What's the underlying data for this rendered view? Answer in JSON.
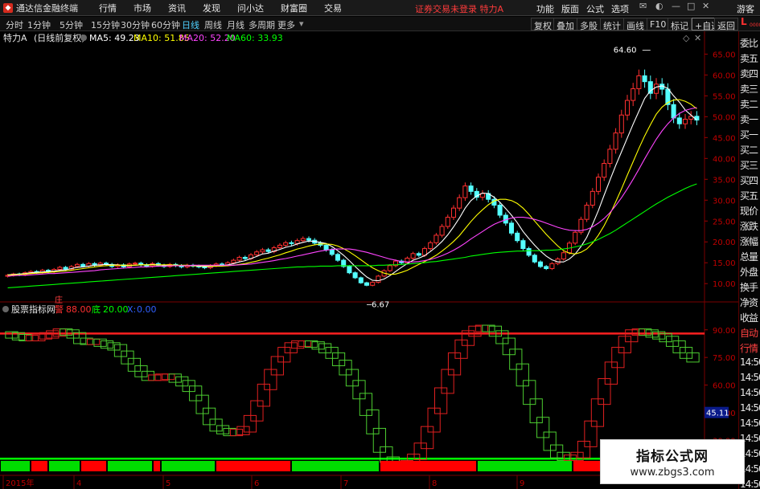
{
  "app": {
    "title": "通达信金融终端",
    "menu": [
      "行情",
      "市场",
      "资讯",
      "发现",
      "问小达",
      "财富圈",
      "交易"
    ],
    "login_status": "证券交易未登录 特力A",
    "right_menu": [
      "功能",
      "版面",
      "公式",
      "选项"
    ],
    "guest": "游客"
  },
  "periods": [
    "分时",
    "1分钟",
    "5分钟",
    "15分钟",
    "30分钟",
    "60分钟",
    "日线",
    "周线",
    "月线",
    "多周期",
    "更多"
  ],
  "active_period": "日线",
  "toolbar_buttons": [
    "复权",
    "叠加",
    "多股",
    "统计",
    "画线",
    "F10",
    "标记",
    "+自选",
    "返回"
  ],
  "main_chart_header": {
    "name": "特力A",
    "mode": "(日线前复权)",
    "ma": [
      {
        "label": "MA5: 49.23",
        "color": "#ffffff"
      },
      {
        "label": "MA10: 51.85",
        "color": "#ffff00"
      },
      {
        "label": "MA20: 52.20",
        "color": "#ff44ff"
      },
      {
        "label": "MA60: 33.93",
        "color": "#00ff00"
      }
    ]
  },
  "indicator_header": {
    "name": "股票指标网",
    "tag": "庄",
    "items": [
      {
        "label": "88.00",
        "prefix": "警",
        "color": "#ff3030"
      },
      {
        "label": "20.00",
        "prefix": "底",
        "color": "#00ff00"
      },
      {
        "label": "0.00",
        "prefix": "X:",
        "color": "#3060ff"
      }
    ]
  },
  "side_panel": [
    "委比",
    "卖五",
    "卖四",
    "卖三",
    "卖二",
    "卖一",
    "买一",
    "买二",
    "买三",
    "买四",
    "买五",
    "现价",
    "涨跌",
    "涨幅",
    "总量",
    "外盘",
    "换手",
    "净资",
    "收益",
    "自动",
    "行情",
    "14:50",
    "14:50",
    "14:50",
    "14:50",
    "14:50",
    "14:50",
    "14:50",
    "14:50",
    "14:50"
  ],
  "corner_marker": {
    "letter": "L",
    "sub": "0000"
  },
  "watermark": {
    "title": "指标公式网",
    "url": "www.zbgs3.com"
  },
  "chart_data": [
    {
      "type": "candlestick",
      "title": "特力A (日线前复权)",
      "y_ticks": [
        10.0,
        15.0,
        20.0,
        25.0,
        30.0,
        35.0,
        40.0,
        45.0,
        50.0,
        55.0,
        60.0,
        65.0
      ],
      "ylim": [
        6.0,
        67.0
      ],
      "x_labels": [
        "2015年",
        "4",
        "5",
        "6",
        "7",
        "8",
        "9"
      ],
      "annotations": [
        {
          "text": "64.60",
          "x_index": 111,
          "value": 64.6
        },
        {
          "text": "6.67",
          "x_index": 62,
          "value": 6.67
        }
      ],
      "series": [
        {
          "name": "MA5",
          "color": "#ffffff"
        },
        {
          "name": "MA10",
          "color": "#ffff00"
        },
        {
          "name": "MA20",
          "color": "#ff44ff"
        },
        {
          "name": "MA60",
          "color": "#00ff00"
        }
      ],
      "close": [
        12.0,
        12.3,
        12.1,
        12.6,
        12.9,
        12.7,
        13.2,
        12.8,
        13.4,
        13.9,
        13.5,
        14.1,
        14.6,
        14.2,
        14.8,
        14.4,
        14.9,
        14.6,
        14.1,
        14.5,
        14.0,
        14.7,
        14.9,
        14.5,
        14.2,
        14.8,
        14.4,
        14.1,
        14.6,
        14.3,
        14.0,
        14.4,
        14.2,
        14.0,
        13.8,
        14.3,
        14.7,
        14.5,
        15.0,
        15.6,
        16.3,
        16.0,
        16.9,
        17.6,
        18.1,
        17.7,
        18.6,
        19.2,
        19.8,
        19.6,
        20.3,
        20.8,
        20.4,
        19.7,
        19.2,
        18.1,
        17.0,
        15.6,
        14.1,
        12.6,
        11.4,
        10.2,
        9.6,
        10.3,
        11.8,
        13.1,
        14.3,
        15.4,
        15.0,
        16.1,
        17.2,
        16.8,
        18.4,
        19.8,
        21.6,
        23.7,
        25.9,
        28.1,
        30.6,
        33.4,
        32.1,
        30.7,
        31.6,
        30.2,
        28.8,
        26.4,
        24.5,
        22.1,
        20.3,
        18.4,
        16.8,
        15.2,
        14.1,
        13.6,
        14.8,
        15.9,
        17.4,
        19.7,
        22.3,
        25.4,
        28.8,
        32.1,
        35.5,
        38.8,
        42.2,
        46.1,
        50.4,
        53.9,
        56.7,
        59.8,
        58.4,
        55.6,
        57.8,
        56.6,
        52.9,
        49.7,
        48.3,
        49.4,
        50.1,
        49.2
      ],
      "ma5": [
        12.1,
        12.2,
        12.3,
        12.4,
        12.6,
        12.7,
        12.8,
        12.9,
        13.0,
        13.2,
        13.3,
        13.6,
        13.9,
        14.0,
        14.2,
        14.4,
        14.5,
        14.6,
        14.5,
        14.5,
        14.3,
        14.3,
        14.4,
        14.5,
        14.5,
        14.6,
        14.5,
        14.4,
        14.4,
        14.4,
        14.3,
        14.3,
        14.3,
        14.2,
        14.1,
        14.1,
        14.2,
        14.3,
        14.5,
        14.8,
        15.2,
        15.5,
        16.0,
        16.5,
        17.1,
        17.3,
        17.8,
        18.2,
        18.7,
        19.0,
        19.5,
        19.9,
        20.2,
        20.1,
        19.9,
        19.6,
        18.9,
        17.9,
        16.8,
        15.5,
        14.1,
        12.8,
        11.6,
        10.8,
        10.7,
        11.1,
        11.9,
        12.9,
        13.9,
        14.8,
        15.6,
        16.1,
        16.7,
        17.7,
        18.8,
        20.1,
        21.7,
        23.6,
        25.7,
        28.1,
        29.9,
        31.0,
        31.7,
        31.6,
        30.7,
        29.5,
        28.0,
        26.4,
        24.6,
        22.5,
        20.8,
        19.2,
        17.8,
        16.6,
        15.7,
        15.2,
        15.2,
        15.9,
        17.1,
        18.9,
        21.1,
        24.2,
        27.5,
        31.2,
        34.8,
        38.3,
        41.6,
        44.9,
        48.2,
        51.3,
        54.4,
        56.2,
        57.1,
        57.4,
        56.8,
        55.0,
        53.5,
        51.6,
        50.4,
        49.2
      ],
      "ma10": [
        12.0,
        12.1,
        12.2,
        12.3,
        12.4,
        12.5,
        12.6,
        12.7,
        12.8,
        12.9,
        13.0,
        13.2,
        13.4,
        13.6,
        13.8,
        14.0,
        14.2,
        14.3,
        14.4,
        14.4,
        14.4,
        14.4,
        14.4,
        14.5,
        14.5,
        14.5,
        14.5,
        14.5,
        14.5,
        14.4,
        14.4,
        14.4,
        14.3,
        14.3,
        14.3,
        14.2,
        14.2,
        14.2,
        14.3,
        14.4,
        14.6,
        14.8,
        15.1,
        15.4,
        15.8,
        16.1,
        16.5,
        16.9,
        17.4,
        17.8,
        18.3,
        18.6,
        19.0,
        19.3,
        19.5,
        19.5,
        19.4,
        19.0,
        18.4,
        17.6,
        16.7,
        15.7,
        14.7,
        13.8,
        13.1,
        12.5,
        12.2,
        12.3,
        12.7,
        13.2,
        13.9,
        14.6,
        15.3,
        16.0,
        16.8,
        17.8,
        18.9,
        20.1,
        21.5,
        23.2,
        24.9,
        26.4,
        27.7,
        28.9,
        29.8,
        30.2,
        30.2,
        29.9,
        29.2,
        28.1,
        26.6,
        25.0,
        23.4,
        21.8,
        20.4,
        19.0,
        17.9,
        17.3,
        17.1,
        17.5,
        18.3,
        19.7,
        21.6,
        23.9,
        26.6,
        29.6,
        32.7,
        36.0,
        39.2,
        42.4,
        45.4,
        48.1,
        50.6,
        52.3,
        53.4,
        54.0,
        54.1,
        53.7,
        53.0,
        51.9
      ],
      "ma20": [
        11.8,
        11.9,
        12.0,
        12.0,
        12.1,
        12.2,
        12.3,
        12.4,
        12.4,
        12.5,
        12.6,
        12.7,
        12.8,
        12.9,
        13.0,
        13.1,
        13.3,
        13.4,
        13.5,
        13.6,
        13.7,
        13.8,
        13.9,
        14.0,
        14.0,
        14.1,
        14.2,
        14.2,
        14.3,
        14.3,
        14.3,
        14.3,
        14.4,
        14.4,
        14.4,
        14.4,
        14.4,
        14.4,
        14.4,
        14.4,
        14.5,
        14.6,
        14.7,
        14.9,
        15.1,
        15.3,
        15.5,
        15.8,
        16.0,
        16.3,
        16.6,
        16.9,
        17.2,
        17.5,
        17.8,
        18.0,
        18.2,
        18.3,
        18.3,
        18.3,
        18.1,
        17.8,
        17.5,
        17.1,
        16.7,
        16.3,
        15.9,
        15.6,
        15.3,
        15.2,
        15.2,
        15.3,
        15.5,
        15.8,
        16.2,
        16.7,
        17.3,
        18.0,
        18.8,
        19.7,
        20.7,
        21.6,
        22.5,
        23.4,
        24.2,
        24.8,
        25.3,
        25.7,
        25.9,
        25.9,
        25.7,
        25.4,
        25.0,
        24.5,
        24.0,
        23.5,
        23.1,
        22.8,
        22.7,
        22.7,
        23.0,
        23.6,
        24.5,
        25.6,
        27.0,
        28.7,
        30.6,
        32.7,
        35.0,
        37.4,
        39.9,
        42.3,
        44.6,
        46.6,
        48.3,
        49.7,
        50.8,
        51.5,
        51.9,
        52.2
      ],
      "ma60": [
        9.0,
        9.1,
        9.2,
        9.3,
        9.4,
        9.5,
        9.6,
        9.7,
        9.8,
        9.9,
        10.0,
        10.1,
        10.2,
        10.3,
        10.4,
        10.5,
        10.6,
        10.7,
        10.8,
        10.9,
        11.0,
        11.1,
        11.2,
        11.3,
        11.4,
        11.5,
        11.6,
        11.7,
        11.8,
        11.9,
        12.0,
        12.1,
        12.2,
        12.3,
        12.4,
        12.5,
        12.6,
        12.7,
        12.8,
        12.9,
        13.0,
        13.1,
        13.2,
        13.3,
        13.4,
        13.5,
        13.6,
        13.7,
        13.8,
        13.9,
        14.0,
        14.0,
        14.1,
        14.1,
        14.2,
        14.2,
        14.2,
        14.3,
        14.3,
        14.3,
        14.3,
        14.3,
        14.3,
        14.3,
        14.4,
        14.4,
        14.5,
        14.5,
        14.6,
        14.7,
        14.8,
        14.9,
        15.0,
        15.2,
        15.3,
        15.5,
        15.7,
        15.9,
        16.1,
        16.3,
        16.6,
        16.8,
        17.0,
        17.2,
        17.4,
        17.5,
        17.6,
        17.7,
        17.8,
        17.8,
        17.9,
        17.9,
        17.9,
        18.0,
        18.0,
        18.1,
        18.3,
        18.5,
        18.8,
        19.1,
        19.5,
        20.0,
        20.6,
        21.3,
        22.0,
        22.8,
        23.7,
        24.6,
        25.5,
        26.4,
        27.3,
        28.2,
        29.1,
        29.9,
        30.7,
        31.4,
        32.1,
        32.8,
        33.4,
        33.9
      ]
    },
    {
      "type": "line",
      "title": "股票指标网",
      "y_ticks": [
        30.0,
        45.0,
        60.0,
        75.0,
        90.0
      ],
      "ylim": [
        21.0,
        96.0
      ],
      "current_value": "45.11",
      "reference_lines": [
        {
          "value": 88.0,
          "color": "#ff2020"
        },
        {
          "value": 20.0,
          "color": "#00ff00"
        }
      ],
      "values": [
        87.5,
        87.0,
        86.0,
        85.5,
        85.5,
        86.5,
        87.0,
        88.0,
        89.0,
        88.5,
        87.0,
        84.0,
        83.5,
        83.5,
        82.5,
        81.5,
        80.5,
        77.0,
        73.0,
        69.0,
        66.0,
        64.0,
        64.0,
        64.5,
        64.5,
        63.0,
        61.0,
        58.0,
        53.0,
        46.0,
        40.0,
        36.5,
        35.0,
        34.0,
        34.5,
        36.0,
        42.0,
        50.0,
        59.0,
        67.0,
        74.0,
        79.0,
        81.5,
        82.5,
        82.5,
        82.0,
        81.0,
        79.0,
        76.0,
        72.0,
        67.0,
        61.0,
        54.0,
        45.0,
        35.0,
        25.0,
        19.5,
        17.0,
        16.5,
        17.5,
        21.0,
        27.0,
        36.0,
        46.0,
        57.0,
        67.0,
        76.0,
        83.0,
        88.0,
        90.5,
        91.0,
        90.5,
        88.0,
        84.0,
        78.0,
        70.0,
        61.0,
        51.0,
        41.0,
        33.0,
        26.0,
        22.0,
        20.5,
        20.5,
        22.0,
        28.0,
        39.0,
        51.0,
        62.0,
        71.0,
        79.0,
        85.0,
        88.5,
        89.0,
        88.5,
        87.5,
        86.5,
        85.0,
        82.5,
        79.0,
        76.0,
        74.0
      ]
    }
  ]
}
